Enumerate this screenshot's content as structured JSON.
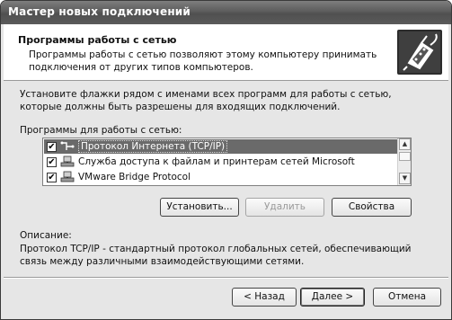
{
  "window": {
    "title": "Мастер новых подключений"
  },
  "header": {
    "title": "Программы работы с сетью",
    "subtitle": "Программы работы с сетью позволяют этому компьютеру принимать подключения от других типов компьютеров."
  },
  "instructions": "Установите флажки рядом с именами всех программ для работы с сетью, которые должны быть разрешены для входящих подключений.",
  "list": {
    "caption": "Программы для работы с сетью:",
    "items": [
      {
        "label": "Протокол Интернета (TCP/IP)",
        "checked": true,
        "selected": true,
        "icon": "network-protocol-icon"
      },
      {
        "label": "Служба доступа к файлам и принтерам сетей Microsoft",
        "checked": true,
        "selected": false,
        "icon": "network-service-icon"
      },
      {
        "label": "VMware Bridge Protocol",
        "checked": true,
        "selected": false,
        "icon": "network-service-icon"
      }
    ],
    "check_mark": "✔",
    "scroll_up": "▲",
    "scroll_down": "▼"
  },
  "actions": {
    "install": "Установить...",
    "remove": "Удалить",
    "properties": "Свойства"
  },
  "description": {
    "caption": "Описание:",
    "text": "Протокол TCP/IP - стандартный протокол глобальных сетей, обеспечивающий связь между различными взаимодействующими сетями."
  },
  "footer": {
    "back": "< Назад",
    "next": "Далее >",
    "cancel": "Отмена"
  }
}
